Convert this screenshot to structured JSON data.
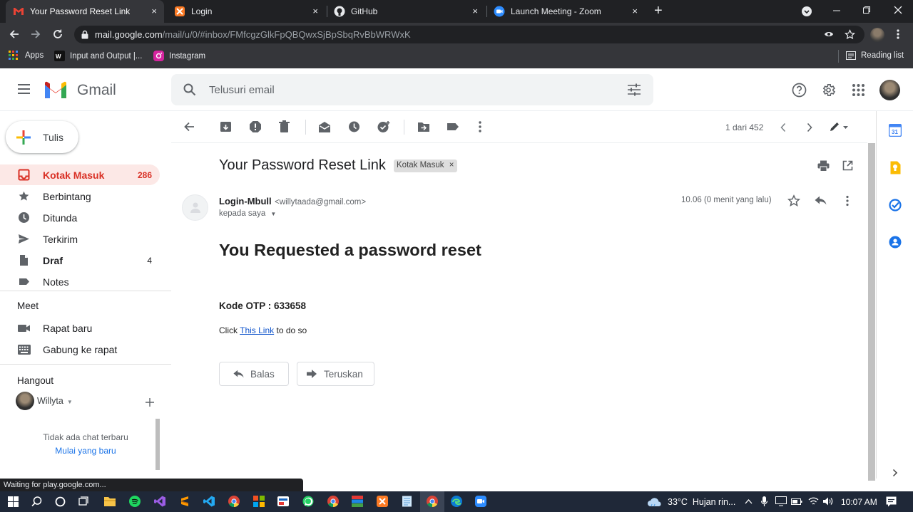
{
  "browser": {
    "tabs": [
      {
        "label": "Your Password Reset Link - willyt",
        "active": true
      },
      {
        "label": "Login",
        "active": false
      },
      {
        "label": "GitHub",
        "active": false
      },
      {
        "label": "Launch Meeting - Zoom",
        "active": false
      }
    ],
    "close_glyph": "×",
    "new_tab_glyph": "+",
    "url_host": "mail.google.com",
    "url_path": "/mail/u/0/#inbox/FMfcgzGlkFpQBQwxSjBpSbqRvBbWRWxK",
    "bookmarks": {
      "apps": "Apps",
      "io": "Input and Output |...",
      "instagram": "Instagram",
      "reading_list": "Reading list"
    },
    "status_text": "Waiting for play.google.com..."
  },
  "gmail": {
    "brand": "Gmail",
    "search_placeholder": "Telusuri email",
    "compose_label": "Tulis",
    "nav": [
      {
        "label": "Kotak Masuk",
        "count": "286",
        "icon": "inbox-icon",
        "selected": true
      },
      {
        "label": "Berbintang",
        "count": "",
        "icon": "star-icon",
        "selected": false
      },
      {
        "label": "Ditunda",
        "count": "",
        "icon": "clock-icon",
        "selected": false
      },
      {
        "label": "Terkirim",
        "count": "",
        "icon": "send-icon",
        "selected": false
      },
      {
        "label": "Draf",
        "count": "4",
        "icon": "draft-icon",
        "selected": false
      },
      {
        "label": "Notes",
        "count": "",
        "icon": "label-icon",
        "selected": false
      }
    ],
    "meet": {
      "title": "Meet",
      "new_meeting": "Rapat baru",
      "join_meeting": "Gabung ke rapat"
    },
    "hangout": {
      "title": "Hangout",
      "user": "Willyta",
      "no_chats": "Tidak ada chat terbaru",
      "start_new": "Mulai yang baru"
    },
    "pager": "1 dari 452",
    "email": {
      "subject": "Your Password Reset Link",
      "label_chip": "Kotak Masuk",
      "chip_close": "×",
      "sender_name": "Login-Mbull",
      "sender_email": "<willytaada@gmail.com>",
      "to": "kepada saya",
      "time": "10.06 (0 menit yang lalu)",
      "heading": "You Requested a password reset",
      "otp_line": "Kode OTP : 633658",
      "click_prefix": "Click ",
      "link_text": "This Link",
      "click_suffix": " to do so",
      "reply_label": "Balas",
      "forward_label": "Teruskan"
    }
  },
  "taskbar": {
    "weather": "33°C  Hujan rin...",
    "clock": "10:07 AM"
  },
  "colors": {
    "chrome_dark": "#202124",
    "chrome_mid": "#35363a",
    "gmail_red": "#d93025",
    "nav_selected_bg": "#fce8e6",
    "link_blue": "#1a73e8",
    "taskbar": "#1f2838"
  }
}
